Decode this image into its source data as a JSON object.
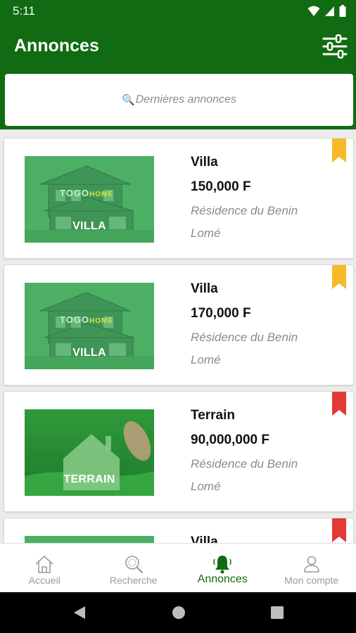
{
  "status_bar": {
    "time": "5:11"
  },
  "header": {
    "title": "Annonces",
    "search_placeholder": "Dernières annonces"
  },
  "listings": [
    {
      "title": "Villa",
      "price": "150,000 F",
      "residence": "Résidence du Benin",
      "city": "Lomé",
      "thumb_label": "VILLA",
      "thumb_type": "house",
      "bookmark_color": "#f6b928"
    },
    {
      "title": "Villa",
      "price": "170,000 F",
      "residence": "Résidence du Benin",
      "city": "Lomé",
      "thumb_label": "VILLA",
      "thumb_type": "house",
      "bookmark_color": "#f6b928"
    },
    {
      "title": "Terrain",
      "price": "90,000,000 F",
      "residence": "Résidence du Benin",
      "city": "Lomé",
      "thumb_label": "TERRAIN",
      "thumb_type": "land",
      "bookmark_color": "#e53935"
    },
    {
      "title": "Villa",
      "price": "",
      "residence": "",
      "city": "",
      "thumb_label": "",
      "thumb_type": "house",
      "bookmark_color": "#e53935"
    }
  ],
  "thumb_watermark": {
    "part1": "TOGO",
    "part2": "HOME"
  },
  "bottom_nav": [
    {
      "label": "Accueil",
      "icon": "home-icon",
      "active": false
    },
    {
      "label": "Recherche",
      "icon": "search-icon",
      "active": false
    },
    {
      "label": "Annonces",
      "icon": "bell-icon",
      "active": true
    },
    {
      "label": "Mon compte",
      "icon": "person-icon",
      "active": false
    }
  ],
  "colors": {
    "brand_green": "#116b12",
    "bookmark_yellow": "#f6b928",
    "bookmark_red": "#e53935"
  }
}
